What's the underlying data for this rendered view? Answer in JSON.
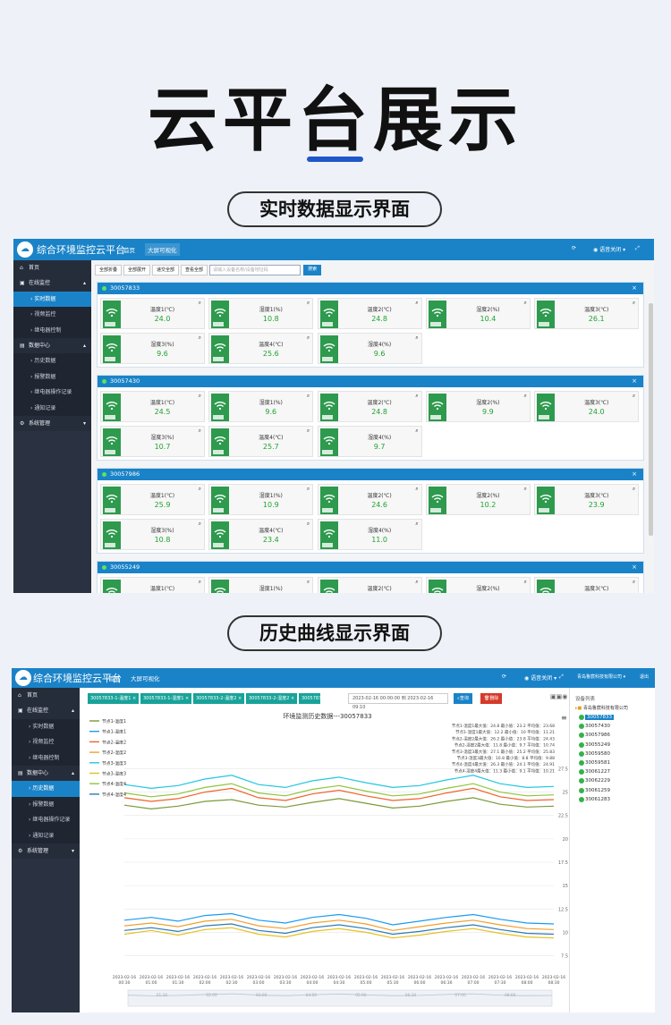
{
  "page": {
    "title": "云平台展示",
    "section1_label": "实时数据显示界面",
    "section2_label": "历史曲线显示界面"
  },
  "app": {
    "brand": "综合环境监控云平台",
    "tabs": [
      "首页",
      "大屏可视化"
    ],
    "sound": "语音关闭",
    "company": "青岛鲁宸科技有限公司",
    "logout": "退出"
  },
  "sidebar": {
    "home": "首页",
    "online_group": "在线监控",
    "online_items": [
      "实时数据",
      "视频监控",
      "继电器控制"
    ],
    "data_group": "数据中心",
    "data_items": [
      "历史数据",
      "报警数据",
      "继电器操作记录",
      "通知记录"
    ],
    "system": "系统管理"
  },
  "realtime": {
    "toolbar": [
      "全部折叠",
      "全部展开",
      "递交全部",
      "查看全部"
    ],
    "search_placeholder": "请输入设备名称/设备地址码",
    "search_button": "搜索",
    "devices": [
      {
        "id": "30057833",
        "cards": [
          {
            "label": "温度1(℃)",
            "value": "24.0"
          },
          {
            "label": "湿度1(%)",
            "value": "10.8"
          },
          {
            "label": "温度2(℃)",
            "value": "24.8"
          },
          {
            "label": "湿度2(%)",
            "value": "10.4"
          },
          {
            "label": "温度3(℃)",
            "value": "26.1"
          },
          {
            "label": "湿度3(%)",
            "value": "9.6"
          },
          {
            "label": "温度4(℃)",
            "value": "25.6"
          },
          {
            "label": "湿度4(%)",
            "value": "9.6"
          }
        ]
      },
      {
        "id": "30057430",
        "cards": [
          {
            "label": "温度1(℃)",
            "value": "24.5"
          },
          {
            "label": "湿度1(%)",
            "value": "9.6"
          },
          {
            "label": "温度2(℃)",
            "value": "24.8"
          },
          {
            "label": "湿度2(%)",
            "value": "9.9"
          },
          {
            "label": "温度3(℃)",
            "value": "24.0"
          },
          {
            "label": "湿度3(%)",
            "value": "10.7"
          },
          {
            "label": "温度4(℃)",
            "value": "25.7"
          },
          {
            "label": "湿度4(%)",
            "value": "9.7"
          }
        ]
      },
      {
        "id": "30057986",
        "cards": [
          {
            "label": "温度1(℃)",
            "value": "25.9"
          },
          {
            "label": "湿度1(%)",
            "value": "10.9"
          },
          {
            "label": "温度2(℃)",
            "value": "24.6"
          },
          {
            "label": "湿度2(%)",
            "value": "10.2"
          },
          {
            "label": "温度3(℃)",
            "value": "23.9"
          },
          {
            "label": "湿度3(%)",
            "value": "10.8"
          },
          {
            "label": "温度4(℃)",
            "value": "23.4"
          },
          {
            "label": "湿度4(%)",
            "value": "11.0"
          }
        ]
      },
      {
        "id": "30055249",
        "cards": [
          {
            "label": "温度1(℃)",
            "value": ""
          },
          {
            "label": "湿度1(%)",
            "value": ""
          },
          {
            "label": "温度2(℃)",
            "value": ""
          },
          {
            "label": "湿度2(%)",
            "value": ""
          },
          {
            "label": "温度3(℃)",
            "value": ""
          }
        ]
      }
    ]
  },
  "history": {
    "channel_tags": [
      "30057833-1-温度1",
      "30057833-1-湿度1",
      "30057833-2-温度2",
      "30057833-2-湿度2",
      "30057833"
    ],
    "date_range": "2023-02-16 00:00:00 到 2023-02-16 09:10",
    "query_button": "查询",
    "delete_button": "删除",
    "device_list_title": "设备列表",
    "company_node": "青岛鲁宸科技有限公司",
    "devices": [
      "30057833",
      "30057430",
      "30057986",
      "30055249",
      "30059580",
      "30059581",
      "30061227",
      "30062229",
      "30061259",
      "30061283"
    ],
    "stats": [
      "节点1-温度1最大值：24.8 最小值：23.2 平均值：23.68",
      "节点1-湿度1最大值：12.2 最小值：10 平均值：11.21",
      "节点2-温度2最大值：26.2 最小值：23.8 平均值：24.43",
      "节点2-湿度2最大值：11.8 最小值：9.7 平均值：10.74",
      "节点3-温度3最大值：27.1 最小值：25.2 平均值：25.83",
      "节点3-湿度3最大值：10.8 最小值：8.8 平均值：9.88",
      "节点4-温度4最大值：26.3 最小值：24.1 平均值：24.91",
      "节点4-湿度4最大值：11.3 最小值：9.1 平均值：10.21"
    ]
  },
  "chart_data": {
    "type": "line",
    "title": "环境监测历史数据---30057833",
    "x": [
      "2023-02-16 00:30",
      "2023-02-16 01:00",
      "2023-02-16 01:30",
      "2023-02-16 02:00",
      "2023-02-16 02:30",
      "2023-02-16 03:00",
      "2023-02-16 03:30",
      "2023-02-16 04:00",
      "2023-02-16 04:30",
      "2023-02-16 05:00",
      "2023-02-16 05:30",
      "2023-02-16 06:00",
      "2023-02-16 06:30",
      "2023-02-16 07:00",
      "2023-02-16 07:30",
      "2023-02-16 08:00",
      "2023-02-16 08:30"
    ],
    "yticks": [
      "27.5",
      "25",
      "22.5",
      "20",
      "17.5",
      "15",
      "12.5",
      "10",
      "7.5"
    ],
    "ylim": [
      6.5,
      28.5
    ],
    "legend_placement": "top-left",
    "colors": [
      "#7b9a3a",
      "#1a9bf0",
      "#f0622a",
      "#f0a030",
      "#22c7e0",
      "#e6c020",
      "#8dc63f",
      "#2a7ab8"
    ],
    "series": [
      {
        "name": "节点1-温度1",
        "values": [
          23.6,
          23.2,
          23.5,
          24.0,
          24.2,
          23.6,
          23.4,
          23.9,
          24.3,
          23.8,
          23.3,
          23.5,
          24.0,
          24.4,
          23.7,
          23.4,
          23.5
        ]
      },
      {
        "name": "节点1-湿度1",
        "values": [
          11.3,
          11.6,
          11.2,
          11.8,
          12.0,
          11.3,
          11.0,
          11.6,
          11.9,
          11.5,
          10.8,
          11.2,
          11.6,
          11.9,
          11.4,
          11.0,
          10.9
        ]
      },
      {
        "name": "节点2-温度2",
        "values": [
          24.4,
          24.0,
          24.3,
          25.0,
          25.4,
          24.4,
          24.1,
          24.8,
          25.2,
          24.6,
          24.1,
          24.3,
          24.9,
          25.4,
          24.5,
          24.1,
          24.2
        ]
      },
      {
        "name": "节点2-湿度2",
        "values": [
          10.7,
          11.0,
          10.6,
          11.2,
          11.4,
          10.7,
          10.4,
          11.0,
          11.3,
          10.9,
          10.2,
          10.6,
          11.0,
          11.3,
          10.8,
          10.4,
          10.3
        ]
      },
      {
        "name": "节点3-温度3",
        "values": [
          25.8,
          25.4,
          25.7,
          26.4,
          26.8,
          25.8,
          25.5,
          26.2,
          26.6,
          26.0,
          25.5,
          25.7,
          26.3,
          26.8,
          25.9,
          25.5,
          25.6
        ]
      },
      {
        "name": "节点3-湿度3",
        "values": [
          9.8,
          10.2,
          9.7,
          10.3,
          10.5,
          9.8,
          9.5,
          10.1,
          10.4,
          10.0,
          9.4,
          9.7,
          10.1,
          10.4,
          9.9,
          9.5,
          9.4
        ]
      },
      {
        "name": "节点4-温度4",
        "values": [
          24.9,
          24.5,
          24.8,
          25.5,
          25.9,
          24.9,
          24.6,
          25.3,
          25.7,
          25.1,
          24.6,
          24.8,
          25.4,
          25.9,
          25.0,
          24.6,
          24.7
        ]
      },
      {
        "name": "节点4-湿度4",
        "values": [
          10.2,
          10.5,
          10.1,
          10.7,
          10.9,
          10.2,
          9.9,
          10.5,
          10.8,
          10.4,
          9.8,
          10.1,
          10.5,
          10.8,
          10.3,
          9.9,
          9.8
        ]
      }
    ]
  }
}
